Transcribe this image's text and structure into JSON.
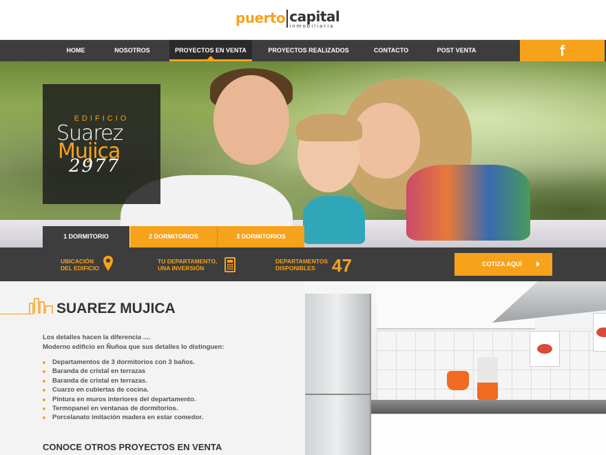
{
  "header": {
    "logo_left": "puerto",
    "logo_right": "capital",
    "logo_sub": "inmobiliaria"
  },
  "nav": {
    "items": [
      {
        "label": "HOME"
      },
      {
        "label": "NOSOTROS"
      },
      {
        "label": "PROYECTOS EN VENTA",
        "active": true
      },
      {
        "label": "PROYECTOS REALIZADOS"
      },
      {
        "label": "CONTACTO"
      },
      {
        "label": "POST VENTA"
      }
    ],
    "social": "f"
  },
  "hero": {
    "building_small": "EDIFICIO",
    "building_line1": "Suarez",
    "building_line2": "Mujica",
    "building_number": "2977"
  },
  "tabs": [
    {
      "label": "1 DORMITORIO",
      "active": true
    },
    {
      "label": "2 DORMITORIOS"
    },
    {
      "label": "3 DORMITORIOS"
    }
  ],
  "infobar": {
    "ubicacion_1": "UBICACIÓN",
    "ubicacion_2": "DEL EDIFICIO",
    "inversion_1": "TU DEPARTAMENTO,",
    "inversion_2": "UNA INVERSIÓN",
    "disponibles_1": "DEPARTAMENTOS",
    "disponibles_2": "DISPONIBLES",
    "disponibles_count": "47",
    "cotiza": "COTIZA AQUÍ"
  },
  "content": {
    "title": "SUAREZ MUJICA",
    "desc_1": "Los detalles hacen la diferencia ....",
    "desc_2": "Moderno edificio en Ñuñoa que sus detalles lo distinguen:",
    "features": [
      "Departamentos de 3 dormitorios con 3 baños.",
      "Baranda de cristal en terrazas",
      "Baranda de cristal en terrazas.",
      "Cuarzo en cubiertas de cocina.",
      "Pintura en muros interiores del departamento.",
      "Termopanel en ventanas de dormitorios.",
      "Porcelanato imitación madera en estar comedor."
    ],
    "others_heading": "CONOCE OTROS PROYECTOS EN VENTA"
  },
  "colors": {
    "accent": "#f7a21b",
    "dark": "#3d3d3d"
  }
}
